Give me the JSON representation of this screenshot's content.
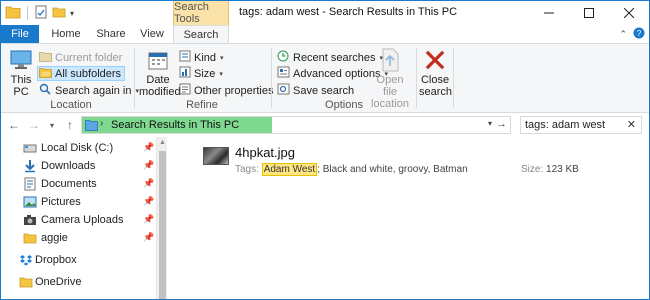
{
  "window": {
    "title": "tags: adam west - Search Results in This PC",
    "context_tab": "Search Tools"
  },
  "tabs": [
    {
      "label": "File"
    },
    {
      "label": "Home"
    },
    {
      "label": "Share"
    },
    {
      "label": "View"
    },
    {
      "label": "Search"
    }
  ],
  "ribbon": {
    "location": {
      "label": "Location",
      "this_pc": "This PC",
      "current_folder": "Current folder",
      "all_subfolders": "All subfolders",
      "search_again_in": "Search again in"
    },
    "refine": {
      "label": "Refine",
      "date_modified": "Date modified",
      "kind": "Kind",
      "size": "Size",
      "other_properties": "Other properties"
    },
    "options": {
      "label": "Options",
      "recent_searches": "Recent searches",
      "advanced_options": "Advanced options",
      "save_search": "Save search",
      "open_file_location": "Open file location"
    },
    "close": {
      "close_search": "Close search"
    }
  },
  "address": {
    "path": "Search Results in This PC",
    "search_value": "tags: adam west"
  },
  "nav": {
    "items": [
      {
        "label": "Local Disk (C:)",
        "icon": "drive-icon",
        "pinned": true
      },
      {
        "label": "Downloads",
        "icon": "downloads-icon",
        "pinned": true
      },
      {
        "label": "Documents",
        "icon": "documents-icon",
        "pinned": true
      },
      {
        "label": "Pictures",
        "icon": "pictures-icon",
        "pinned": true
      },
      {
        "label": "Camera Uploads",
        "icon": "camera-icon",
        "pinned": true
      },
      {
        "label": "aggie",
        "icon": "folder-icon",
        "pinned": true
      },
      {
        "label": "Dropbox",
        "icon": "dropbox-icon",
        "pinned": false
      },
      {
        "label": "OneDrive",
        "icon": "onedrive-icon",
        "pinned": false
      }
    ]
  },
  "results": [
    {
      "name": "4hpkat.jpg",
      "tags_label": "Tags:",
      "tag_highlight": "Adam West",
      "tags_rest": "; Black and white, groovy, Batman",
      "size_label": "Size:",
      "size": "123 KB"
    }
  ],
  "colors": {
    "accent": "#1979ca",
    "context_tab": "#fbe2a8",
    "progress": "#7fd88f",
    "highlight": "#ffe680",
    "close_x": "#c42b1c"
  }
}
